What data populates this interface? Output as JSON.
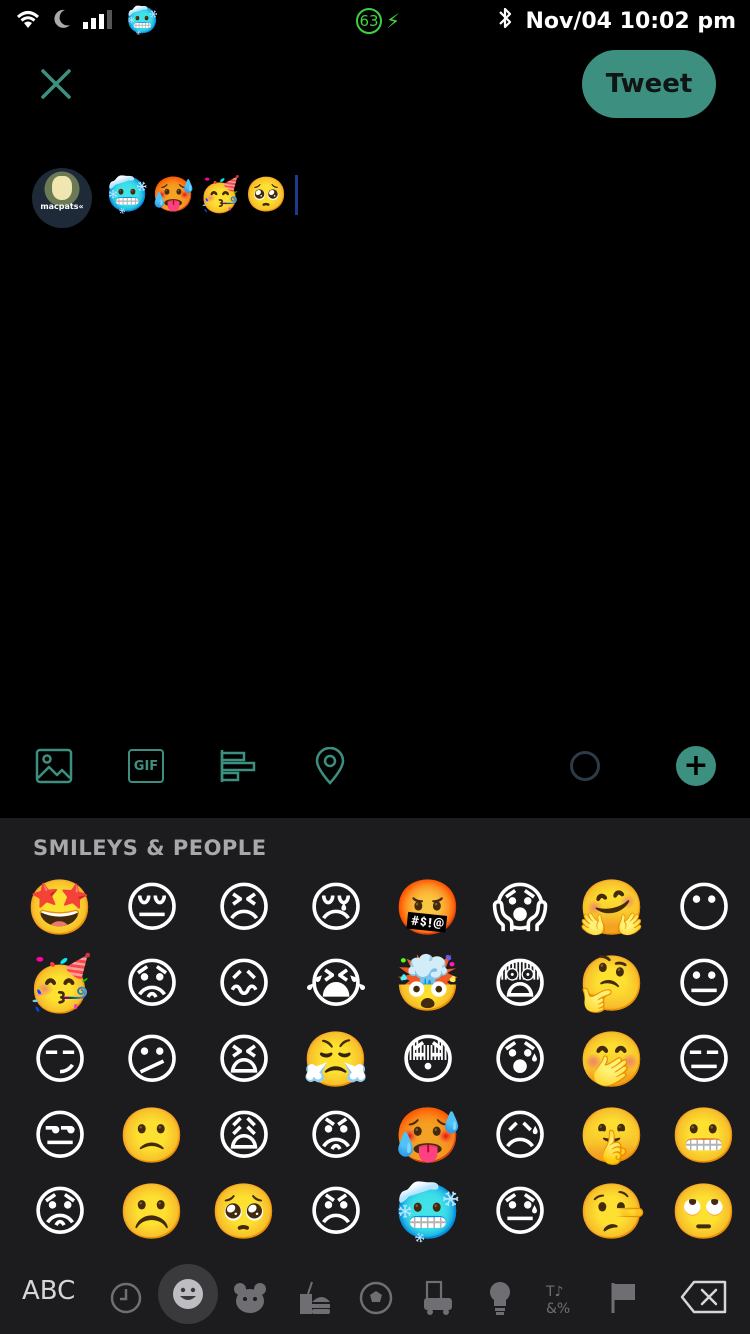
{
  "status_bar": {
    "time": "Nov/04 10:02 pm",
    "battery": "63",
    "icons": [
      "wifi-icon",
      "moon-icon",
      "signal-icon",
      "bluetooth-icon",
      "charging-bolt-icon"
    ],
    "status_emoji": "🥶"
  },
  "header": {
    "tweet_label": "Tweet"
  },
  "compose": {
    "avatar_text": "macpats«",
    "text": "🥶🥵🥳🥺"
  },
  "toolbar": {
    "gif_label": "GIF",
    "items": [
      "image-icon",
      "gif-icon",
      "poll-icon",
      "location-icon",
      "progress-ring",
      "add-icon"
    ]
  },
  "keyboard": {
    "category_title": "SMILEYS & PEOPLE",
    "emojis": [
      "🤩",
      "😔",
      "😣",
      "😢",
      "🤬",
      "😱",
      "🤗",
      "😶",
      "🥳",
      "😟",
      "😖",
      "😭",
      "🤯",
      "😨",
      "🤔",
      "😐",
      "😏",
      "😕",
      "😫",
      "😤",
      "😳",
      "😰",
      "🤭",
      "😑",
      "😒",
      "🙁",
      "😩",
      "😡",
      "🥵",
      "😥",
      "🤫",
      "😬",
      "😟",
      "☹️",
      "🥺",
      "😠",
      "🥶",
      "😓",
      "🤥",
      "🙄"
    ],
    "abc_label": "ABC",
    "categories": [
      "recent-icon",
      "smiley-icon",
      "animal-icon",
      "food-icon",
      "activity-icon",
      "travel-icon",
      "objects-icon",
      "symbols-icon",
      "flag-icon"
    ]
  },
  "colors": {
    "accent": "#3d8f7f",
    "background": "#000000",
    "keyboard_bg": "#1c1c1e"
  }
}
